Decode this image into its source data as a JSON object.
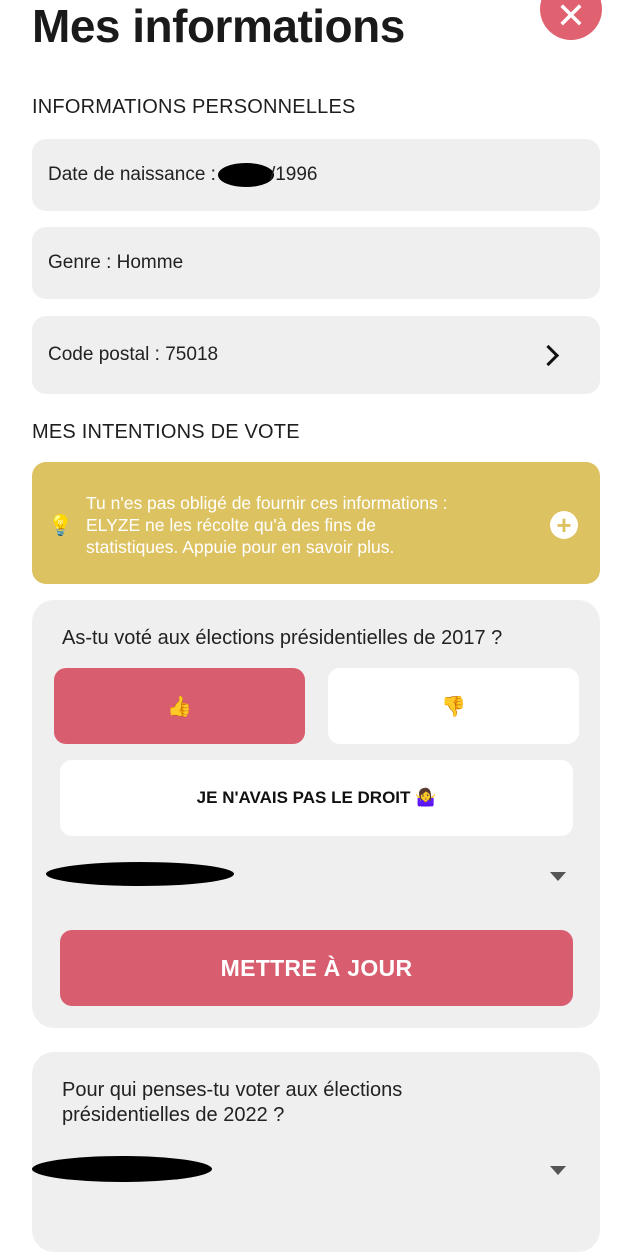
{
  "header": {
    "title": "Mes informations",
    "close_glyph": "✕"
  },
  "personal": {
    "section_title": "INFORMATIONS PERSONNELLES",
    "birthdate_label": "Date de naissance :",
    "birthdate_visible": "/1996",
    "gender": "Genre : Homme",
    "postal": "Code postal : 75018"
  },
  "vote": {
    "section_title": "MES INTENTIONS DE VOTE",
    "info_text": "Tu n'es pas obligé de fournir ces informations : ELYZE ne les récolte qu'à des fins de statistiques. Appuie pour en savoir plus.",
    "bulb_glyph": "💡",
    "plus_glyph": "+",
    "q2017": "As-tu voté aux élections présidentielles de 2017 ?",
    "yes_glyph": "👍",
    "no_glyph": "👎",
    "no_right_label": "JE N'AVAIS PAS LE DROIT 🤷‍♀️",
    "update_label": "METTRE À JOUR",
    "q2022": "Pour qui penses-tu voter aux élections présidentielles de 2022 ?"
  },
  "colors": {
    "accent": "#d85d6e",
    "close": "#e0616f",
    "info_bg": "#ddc262",
    "row_bg": "#efefef"
  }
}
